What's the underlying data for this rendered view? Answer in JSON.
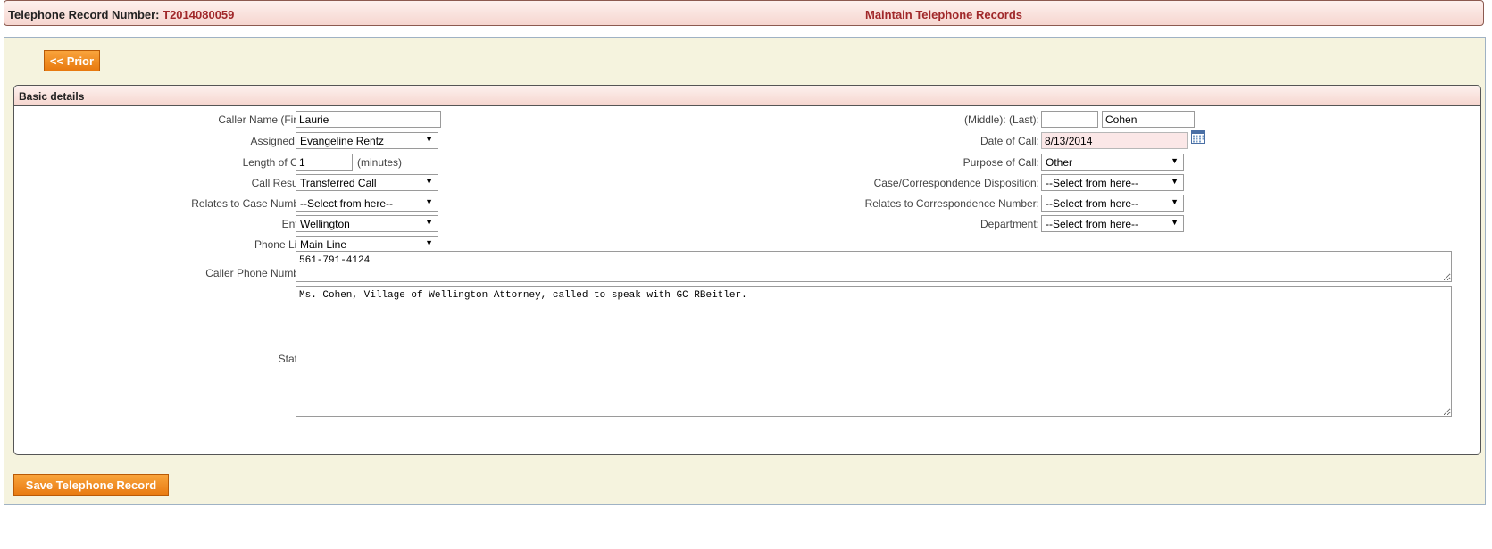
{
  "header": {
    "record_label": "Telephone Record Number:",
    "record_number": "T2014080059",
    "title": "Maintain Telephone Records"
  },
  "buttons": {
    "prior": "<< Prior",
    "save": "Save Telephone Record"
  },
  "section": {
    "legend": "Basic details"
  },
  "form": {
    "caller_first_label": "Caller Name (First):",
    "caller_first": "Laurie",
    "middle_last_label": "(Middle): (Last):",
    "caller_middle": "",
    "caller_last": "Cohen",
    "assigned_to_label": "Assigned To:",
    "assigned_to": "Evangeline Rentz",
    "date_of_call_label": "Date of Call:",
    "date_of_call": "8/13/2014",
    "length_label": "Length of Call:",
    "length": "1",
    "length_unit": "(minutes)",
    "purpose_label": "Purpose of Call:",
    "purpose": "Other",
    "call_results_label": "Call Results:",
    "call_results": "Transferred Call",
    "disposition_label": "Case/Correspondence Disposition:",
    "disposition": "--Select from here--",
    "case_number_label": "Relates to Case Number:",
    "case_number": "--Select from here--",
    "corr_number_label": "Relates to Correspondence Number:",
    "corr_number": "--Select from here--",
    "entity_label": "Entity:",
    "entity": "Wellington",
    "department_label": "Department:",
    "department": "--Select from here--",
    "phone_line_label": "Phone Line:",
    "phone_line": "Main Line",
    "caller_phone_label": "Caller Phone Number:",
    "caller_phone": "561-791-4124",
    "status_label": "Status:",
    "status": "Ms. Cohen, Village of Wellington Attorney, called to speak with GC RBeitler."
  },
  "icons": {
    "calendar": "calendar-icon",
    "dropdown": "chevron-down-icon"
  },
  "colors": {
    "accent_button": "#f08a1c",
    "header_text": "#a0282a",
    "panel_bg": "#f5f3de",
    "date_field_bg": "#fbe7e7"
  }
}
